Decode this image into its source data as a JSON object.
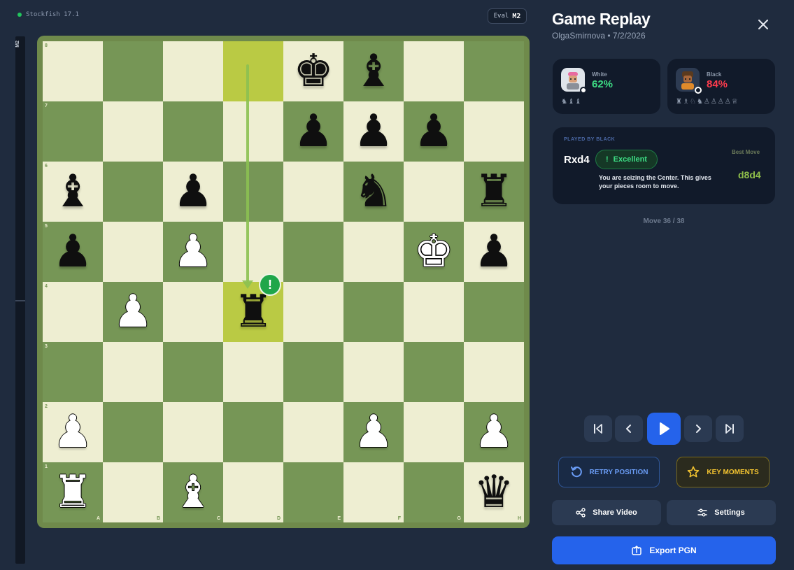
{
  "engine": {
    "name": "Stockfish 17.1"
  },
  "eval": {
    "label": "Eval",
    "value": "M2"
  },
  "evalbar": {
    "label": "M2",
    "white_fraction": 0.5
  },
  "header": {
    "title": "Game Replay",
    "subtitle": "OlgaSmirnova • 7/2/2026",
    "close_icon": "close-icon"
  },
  "players": {
    "white": {
      "name": "White",
      "accuracy": "62%",
      "captured": "♞♝♝",
      "avatar_icon": "white-player-avatar"
    },
    "black": {
      "name": "Black",
      "accuracy": "84%",
      "captured": "♜♗♘♞♙♙♙♙♕",
      "avatar_icon": "black-player-avatar"
    }
  },
  "move": {
    "played_by": "PLAYED BY BLACK",
    "san": "Rxd4",
    "classification": "Excellent",
    "classification_icon": "!",
    "explanation": "You are seizing the Center. This gives your pieces room to move.",
    "best_label": "Best Move",
    "best_move": "d8d4"
  },
  "counter": "Move 36 / 38",
  "controls": {
    "first_icon": "skip-back-icon",
    "prev_icon": "chevron-left-icon",
    "play_icon": "play-icon",
    "next_icon": "chevron-right-icon",
    "last_icon": "skip-forward-icon"
  },
  "actions": {
    "retry": "RETRY POSITION",
    "key_moments": "KEY MOMENTS",
    "share": "Share Video",
    "settings": "Settings",
    "export": "Export PGN"
  },
  "colors": {
    "accent": "#2563eb",
    "white_acc": "#3ddc84",
    "black_acc": "#ff3b4d",
    "excellent": "#1fa64a"
  },
  "board": {
    "files": [
      "A",
      "B",
      "C",
      "D",
      "E",
      "F",
      "G",
      "H"
    ],
    "ranks": [
      "8",
      "7",
      "6",
      "5",
      "4",
      "3",
      "2",
      "1"
    ],
    "rows": [
      [
        "",
        "",
        "",
        "",
        "bK",
        "bB",
        "",
        ""
      ],
      [
        "",
        "",
        "",
        "",
        "bP",
        "bP",
        "bP",
        ""
      ],
      [
        "bB",
        "",
        "bP",
        "",
        "",
        "bN",
        "",
        "bR"
      ],
      [
        "bP",
        "",
        "wP",
        "",
        "",
        "",
        "wK",
        "bP"
      ],
      [
        "",
        "wP",
        "",
        "bR",
        "",
        "",
        "",
        ""
      ],
      [
        "",
        "",
        "",
        "",
        "",
        "",
        "",
        ""
      ],
      [
        "wP",
        "",
        "",
        "",
        "",
        "wP",
        "",
        "wP"
      ],
      [
        "wR",
        "",
        "wB",
        "",
        "",
        "",
        "",
        "bQ"
      ]
    ],
    "highlight": [
      "d8",
      "d4"
    ],
    "arrow": {
      "from": "d8",
      "to": "d4"
    },
    "annotation": {
      "square": "d4",
      "symbol": "!"
    }
  }
}
